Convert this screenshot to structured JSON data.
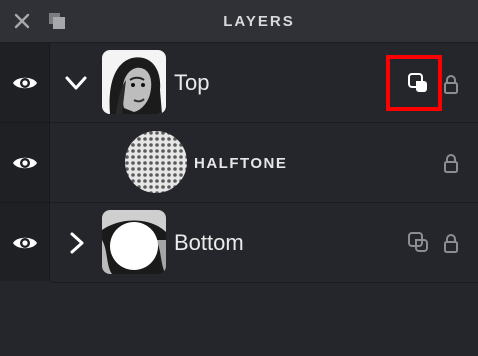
{
  "panel": {
    "title": "LAYERS",
    "icons": [
      "close-icon",
      "collapse-panel-icon"
    ]
  },
  "layers": [
    {
      "name": "Top",
      "expanded": true,
      "visible": true,
      "thumbnail": "portrait-photo",
      "actions": [
        "clipping-mask-icon",
        "lock-icon"
      ],
      "clipping_active": true
    },
    {
      "name": "HALFTONE",
      "type": "effect",
      "visible": true,
      "thumbnail": "halftone-dots",
      "actions": [
        "lock-icon"
      ]
    },
    {
      "name": "Bottom",
      "expanded": false,
      "visible": true,
      "thumbnail": "portrait-with-white-circle",
      "actions": [
        "clipping-mask-icon",
        "lock-icon"
      ],
      "clipping_active": false
    }
  ],
  "colors": {
    "background": "#25262b",
    "header": "#303136",
    "eye_column": "#1f2024",
    "highlight": "#ff0000",
    "text": "#eaeaeb"
  }
}
